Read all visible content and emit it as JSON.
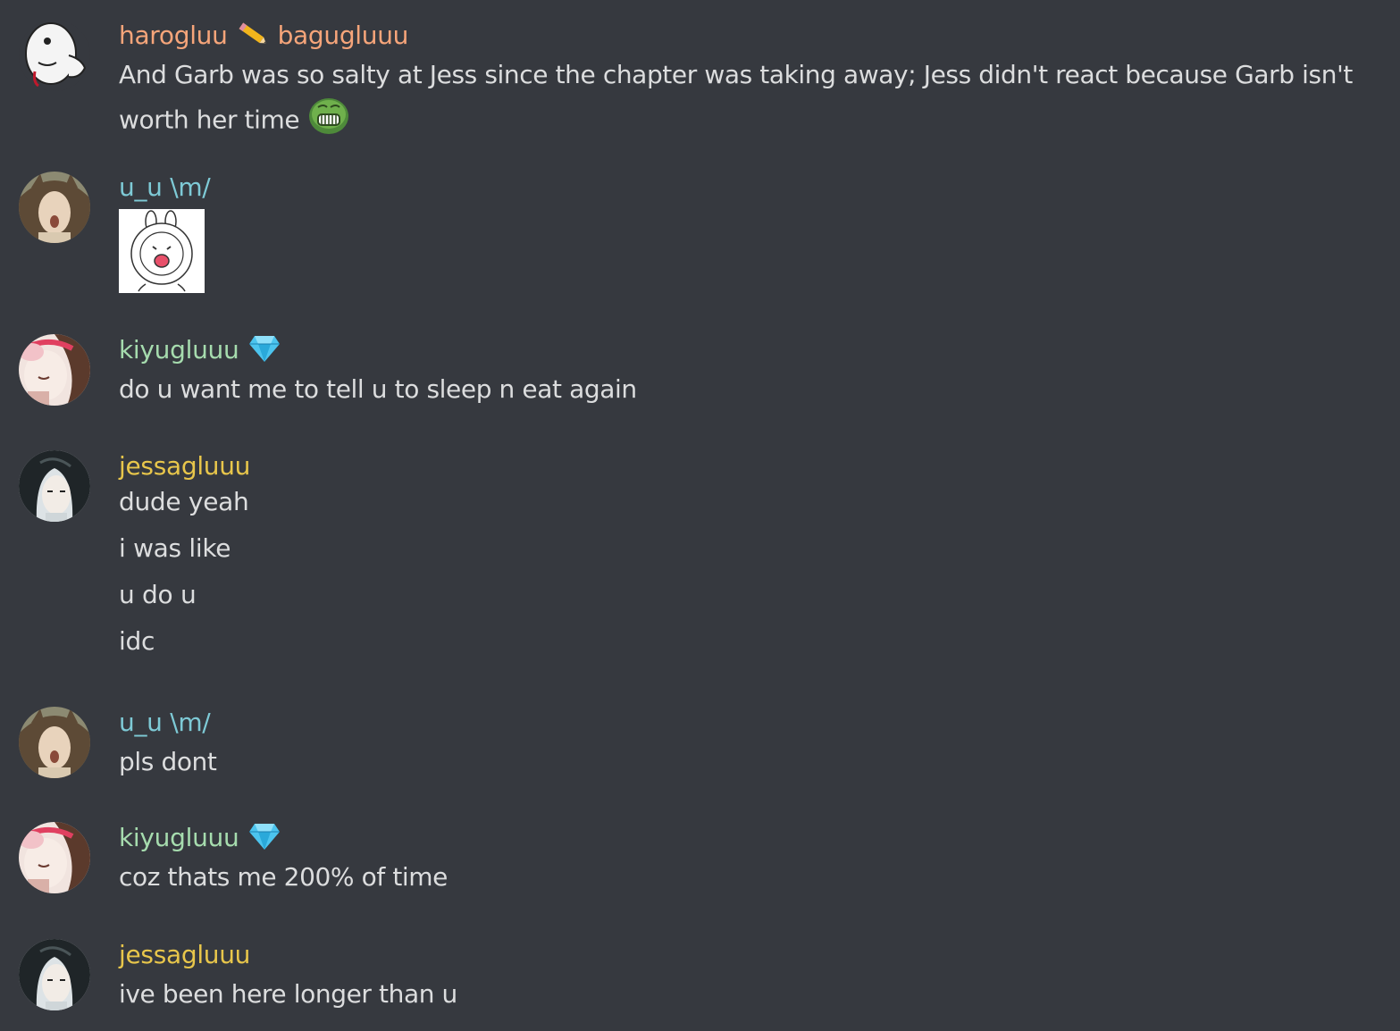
{
  "messages": [
    {
      "author": "harogluu",
      "author2": "bagugluuu",
      "author_color": "#f6a57a",
      "avatar": "ghost-sticker-avatar",
      "lines": [
        "And Garb was so salty at Jess since the chapter was taking away; Jess didn't react because Garb isn't worth her time"
      ]
    },
    {
      "author": "u_u \\m/",
      "author_color": "#7ecad6",
      "avatar": "brown-hair-avatar",
      "sticker": "bunny-sticker"
    },
    {
      "author": "kiyugluuu",
      "author_color": "#a6dcae",
      "badge": "diamond-icon",
      "avatar": "pink-anime-avatar",
      "lines": [
        "do u want me to tell u to sleep n eat again"
      ]
    },
    {
      "author": "jessagluuu",
      "author_color": "#e8c64b",
      "avatar": "dark-hair-anime-avatar",
      "lines": [
        "dude yeah",
        "i was like",
        "u do u",
        "idc"
      ]
    },
    {
      "author": "u_u \\m/",
      "author_color": "#7ecad6",
      "avatar": "brown-hair-avatar",
      "lines": [
        "pls dont"
      ]
    },
    {
      "author": "kiyugluuu",
      "author_color": "#a6dcae",
      "badge": "diamond-icon",
      "avatar": "pink-anime-avatar",
      "lines": [
        "coz thats me 200% of time"
      ]
    },
    {
      "author": "jessagluuu",
      "author_color": "#e8c64b",
      "avatar": "dark-hair-anime-avatar",
      "lines": [
        "ive been here longer than u"
      ]
    }
  ]
}
